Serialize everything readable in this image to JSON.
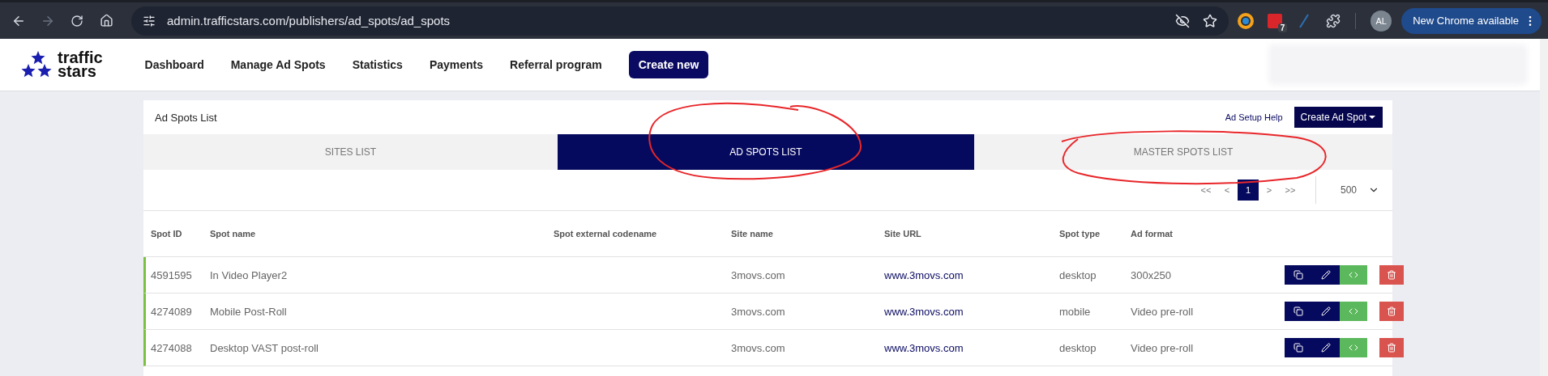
{
  "browser": {
    "url": "admin.trafficstars.com/publishers/ad_spots/ad_spots",
    "extension_badge": "7",
    "avatar": "AL",
    "update_button": "New Chrome available"
  },
  "header": {
    "logo": [
      "traffic",
      "stars"
    ],
    "nav": [
      {
        "label": "Dashboard",
        "kind": "link"
      },
      {
        "label": "Manage Ad Spots",
        "kind": "link"
      },
      {
        "label": "Statistics",
        "kind": "link"
      },
      {
        "label": "Payments",
        "kind": "link"
      },
      {
        "label": "Referral program",
        "kind": "link"
      },
      {
        "label": "Create new",
        "kind": "button"
      }
    ]
  },
  "card": {
    "title": "Ad Spots List",
    "help_link": "Ad Setup Help",
    "create_button": "Create Ad Spot",
    "tabs": [
      {
        "label": "SITES LIST",
        "selected": false
      },
      {
        "label": "AD SPOTS LIST",
        "selected": true
      },
      {
        "label": "MASTER SPOTS LIST",
        "selected": false
      }
    ],
    "pagination": [
      {
        "label": "<<",
        "selected": false
      },
      {
        "label": "<",
        "selected": false
      },
      {
        "label": "1",
        "selected": true
      },
      {
        "label": ">",
        "selected": false
      },
      {
        "label": ">>",
        "selected": false
      }
    ],
    "page_size": "500",
    "table": {
      "columns": [
        "Spot ID",
        "Spot name",
        "Spot external codename",
        "Site name",
        "Site URL",
        "Spot type",
        "Ad format"
      ],
      "rows": [
        {
          "active": true,
          "spot_id": "4591595",
          "spot_name": "In Video Player2",
          "site_name": "3movs.com",
          "site_url": "www.3movs.com",
          "spot_type": "desktop",
          "ad_format": "300x250"
        },
        {
          "active": true,
          "spot_id": "4274089",
          "spot_name": "Mobile Post-Roll",
          "site_name": "3movs.com",
          "site_url": "www.3movs.com",
          "spot_type": "mobile",
          "ad_format": "Video pre-roll"
        },
        {
          "active": true,
          "spot_id": "4274088",
          "spot_name": "Desktop VAST post-roll",
          "site_name": "3movs.com",
          "site_url": "www.3movs.com",
          "spot_type": "desktop",
          "ad_format": "Video pre-roll"
        }
      ]
    }
  },
  "annotations": [
    {
      "kind": "circle"
    },
    {
      "kind": "circle"
    }
  ]
}
